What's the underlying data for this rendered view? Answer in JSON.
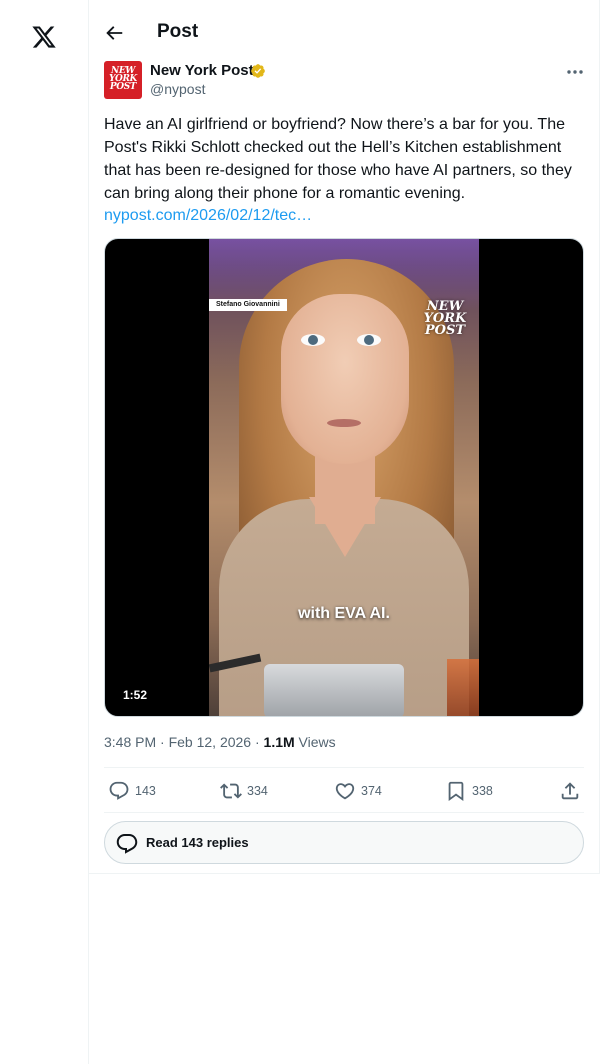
{
  "nav": {
    "logo_icon": "x-logo-icon"
  },
  "header": {
    "title": "Post",
    "back_icon": "back-arrow-icon"
  },
  "post": {
    "author": {
      "name": "New York Post",
      "handle": "@nypost",
      "avatar_text": "NEW YORK POST",
      "verified_badge": "gold-verified-icon"
    },
    "text": "Have an AI girlfriend or boyfriend? Now there’s a bar for you. The Post's Rikki Schlott checked out the Hell’s Kitchen establishment that has been re-designed for those who have AI partners, so they can bring along their phone for a romantic evening.",
    "link": "nypost.com/2026/02/12/tec…",
    "media": {
      "type": "video",
      "duration": "1:52",
      "credit_label": "Stefano Giovannini",
      "watermark_text": "NEW YORK POST",
      "caption_text": "with EVA AI."
    },
    "timestamp": "3:48 PM · Feb 12, 2026 · ",
    "views_count": "1.1M",
    "views_label": " Views",
    "stats": {
      "replies": "143",
      "reposts": "334",
      "likes": "374",
      "bookmarks": "338"
    },
    "read_replies_label": "Read 143 replies"
  },
  "colors": {
    "accent": "#1d9bf0",
    "brand_red": "#d52027",
    "text_primary": "#0f1419",
    "text_secondary": "#536471",
    "verified_gold": "#e2b719"
  }
}
